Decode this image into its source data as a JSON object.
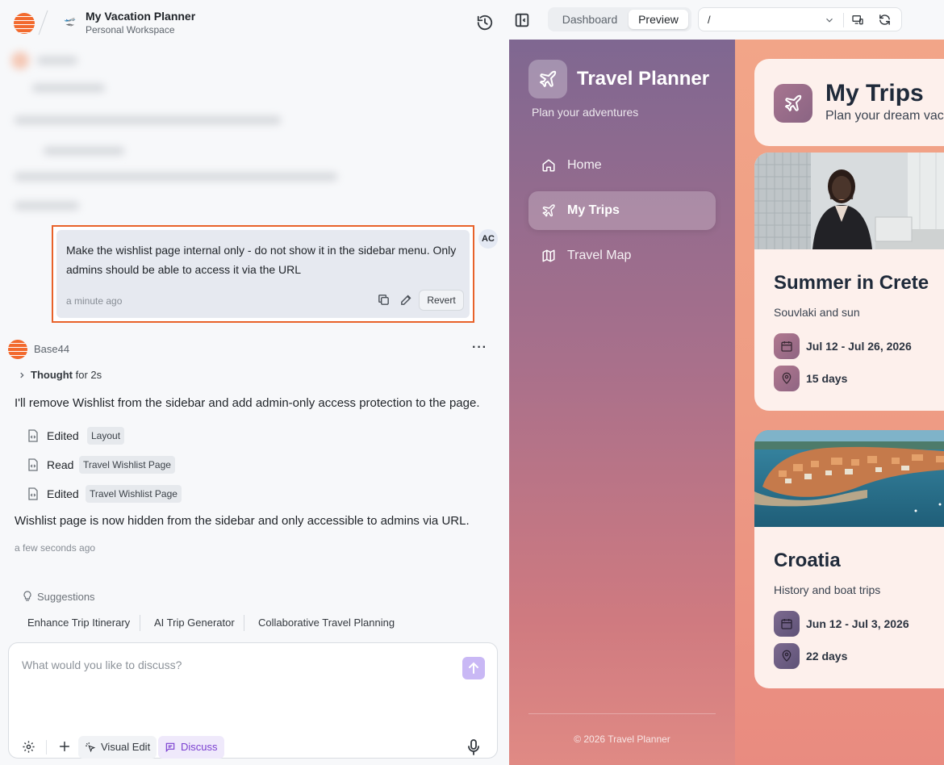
{
  "topbar": {
    "project_name": "My Vacation Planner",
    "workspace": "Personal Workspace",
    "tabs": [
      "Dashboard",
      "Preview"
    ],
    "active_tab": "Preview",
    "url_path": "/"
  },
  "chat": {
    "user_message": {
      "avatar": "AC",
      "text": "Make the wishlist page internal only - do not show it in the sidebar menu. Only admins should be able to access it via the URL",
      "time": "a minute ago",
      "revert_label": "Revert"
    },
    "assistant": {
      "name": "Base44",
      "thought_label": "Thought",
      "thought_duration": "for 2s",
      "intro": "I'll remove Wishlist from the sidebar and add admin-only access protection to the page.",
      "actions": [
        {
          "verb": "Edited",
          "target": "Layout"
        },
        {
          "verb": "Read",
          "target": "Travel Wishlist Page"
        },
        {
          "verb": "Edited",
          "target": "Travel Wishlist Page"
        }
      ],
      "summary": "Wishlist page is now hidden from the sidebar and only accessible to admins via URL.",
      "time": "a few seconds ago"
    },
    "suggestions": {
      "header": "Suggestions",
      "items": [
        "Enhance Trip Itinerary",
        "AI Trip Generator",
        "Collaborative Travel Planning"
      ]
    },
    "composer": {
      "placeholder": "What would you like to discuss?",
      "visual_edit_label": "Visual Edit",
      "discuss_label": "Discuss"
    }
  },
  "preview": {
    "brand": "Travel Planner",
    "tagline": "Plan your adventures",
    "nav": [
      {
        "label": "Home",
        "icon": "home-icon",
        "active": false
      },
      {
        "label": "My Trips",
        "icon": "plane-icon",
        "active": true
      },
      {
        "label": "Travel Map",
        "icon": "map-icon",
        "active": false
      }
    ],
    "footer": "© 2026 Travel Planner",
    "page_title": "My Trips",
    "page_subtitle": "Plan your dream vac",
    "trips": [
      {
        "name": "Summer in Crete",
        "description": "Souvlaki and sun",
        "dates": "Jul 12 - Jul 26, 2026",
        "duration": "15 days"
      },
      {
        "name": "Croatia",
        "description": "History and boat trips",
        "dates": "Jun 12 - Jul 3, 2026",
        "duration": "22 days"
      }
    ]
  },
  "colors": {
    "accent_orange": "#e8622a",
    "discuss_purple": "#7a3fd0",
    "sidebar_top": "#7f6791",
    "sidebar_bottom": "#e08a84"
  }
}
